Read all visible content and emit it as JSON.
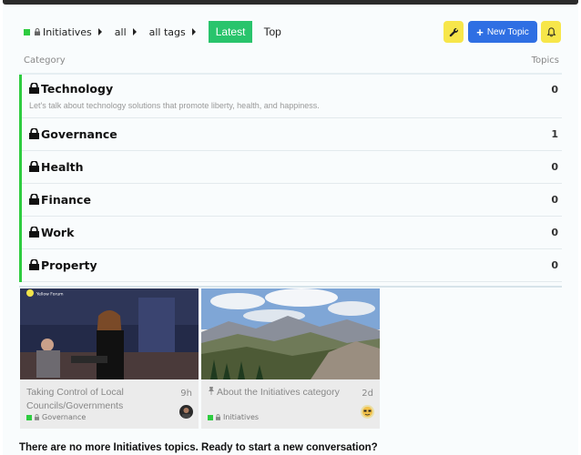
{
  "navigation": {
    "category_crumb": "Initiatives",
    "subcategory_crumb": "all",
    "tags_crumb": "all tags",
    "tabs": [
      {
        "label": "Latest",
        "active": true
      },
      {
        "label": "Top",
        "active": false
      }
    ],
    "new_topic_label": "New Topic",
    "accent_color": "#2ecc40",
    "primary_button_color": "#2f6fe3",
    "icon_button_color": "#f7e64a"
  },
  "table": {
    "category_header": "Category",
    "topics_header": "Topics"
  },
  "categories": [
    {
      "name": "Technology",
      "count": "0",
      "description": "Let's talk about technology solutions that promote liberty, health, and happiness."
    },
    {
      "name": "Governance",
      "count": "1"
    },
    {
      "name": "Health",
      "count": "0"
    },
    {
      "name": "Finance",
      "count": "0"
    },
    {
      "name": "Work",
      "count": "0"
    },
    {
      "name": "Property",
      "count": "0"
    }
  ],
  "topics": [
    {
      "title": "Taking Control of Local Councils/Governments",
      "age": "9h",
      "category": "Governance",
      "thumb_caption": "Yellow Forum",
      "pinned": false
    },
    {
      "title": "About the Initiatives category",
      "age": "2d",
      "category": "Initiatives",
      "pinned": true
    }
  ],
  "footer_message": "There are no more Initiatives topics. Ready to start a new conversation?"
}
